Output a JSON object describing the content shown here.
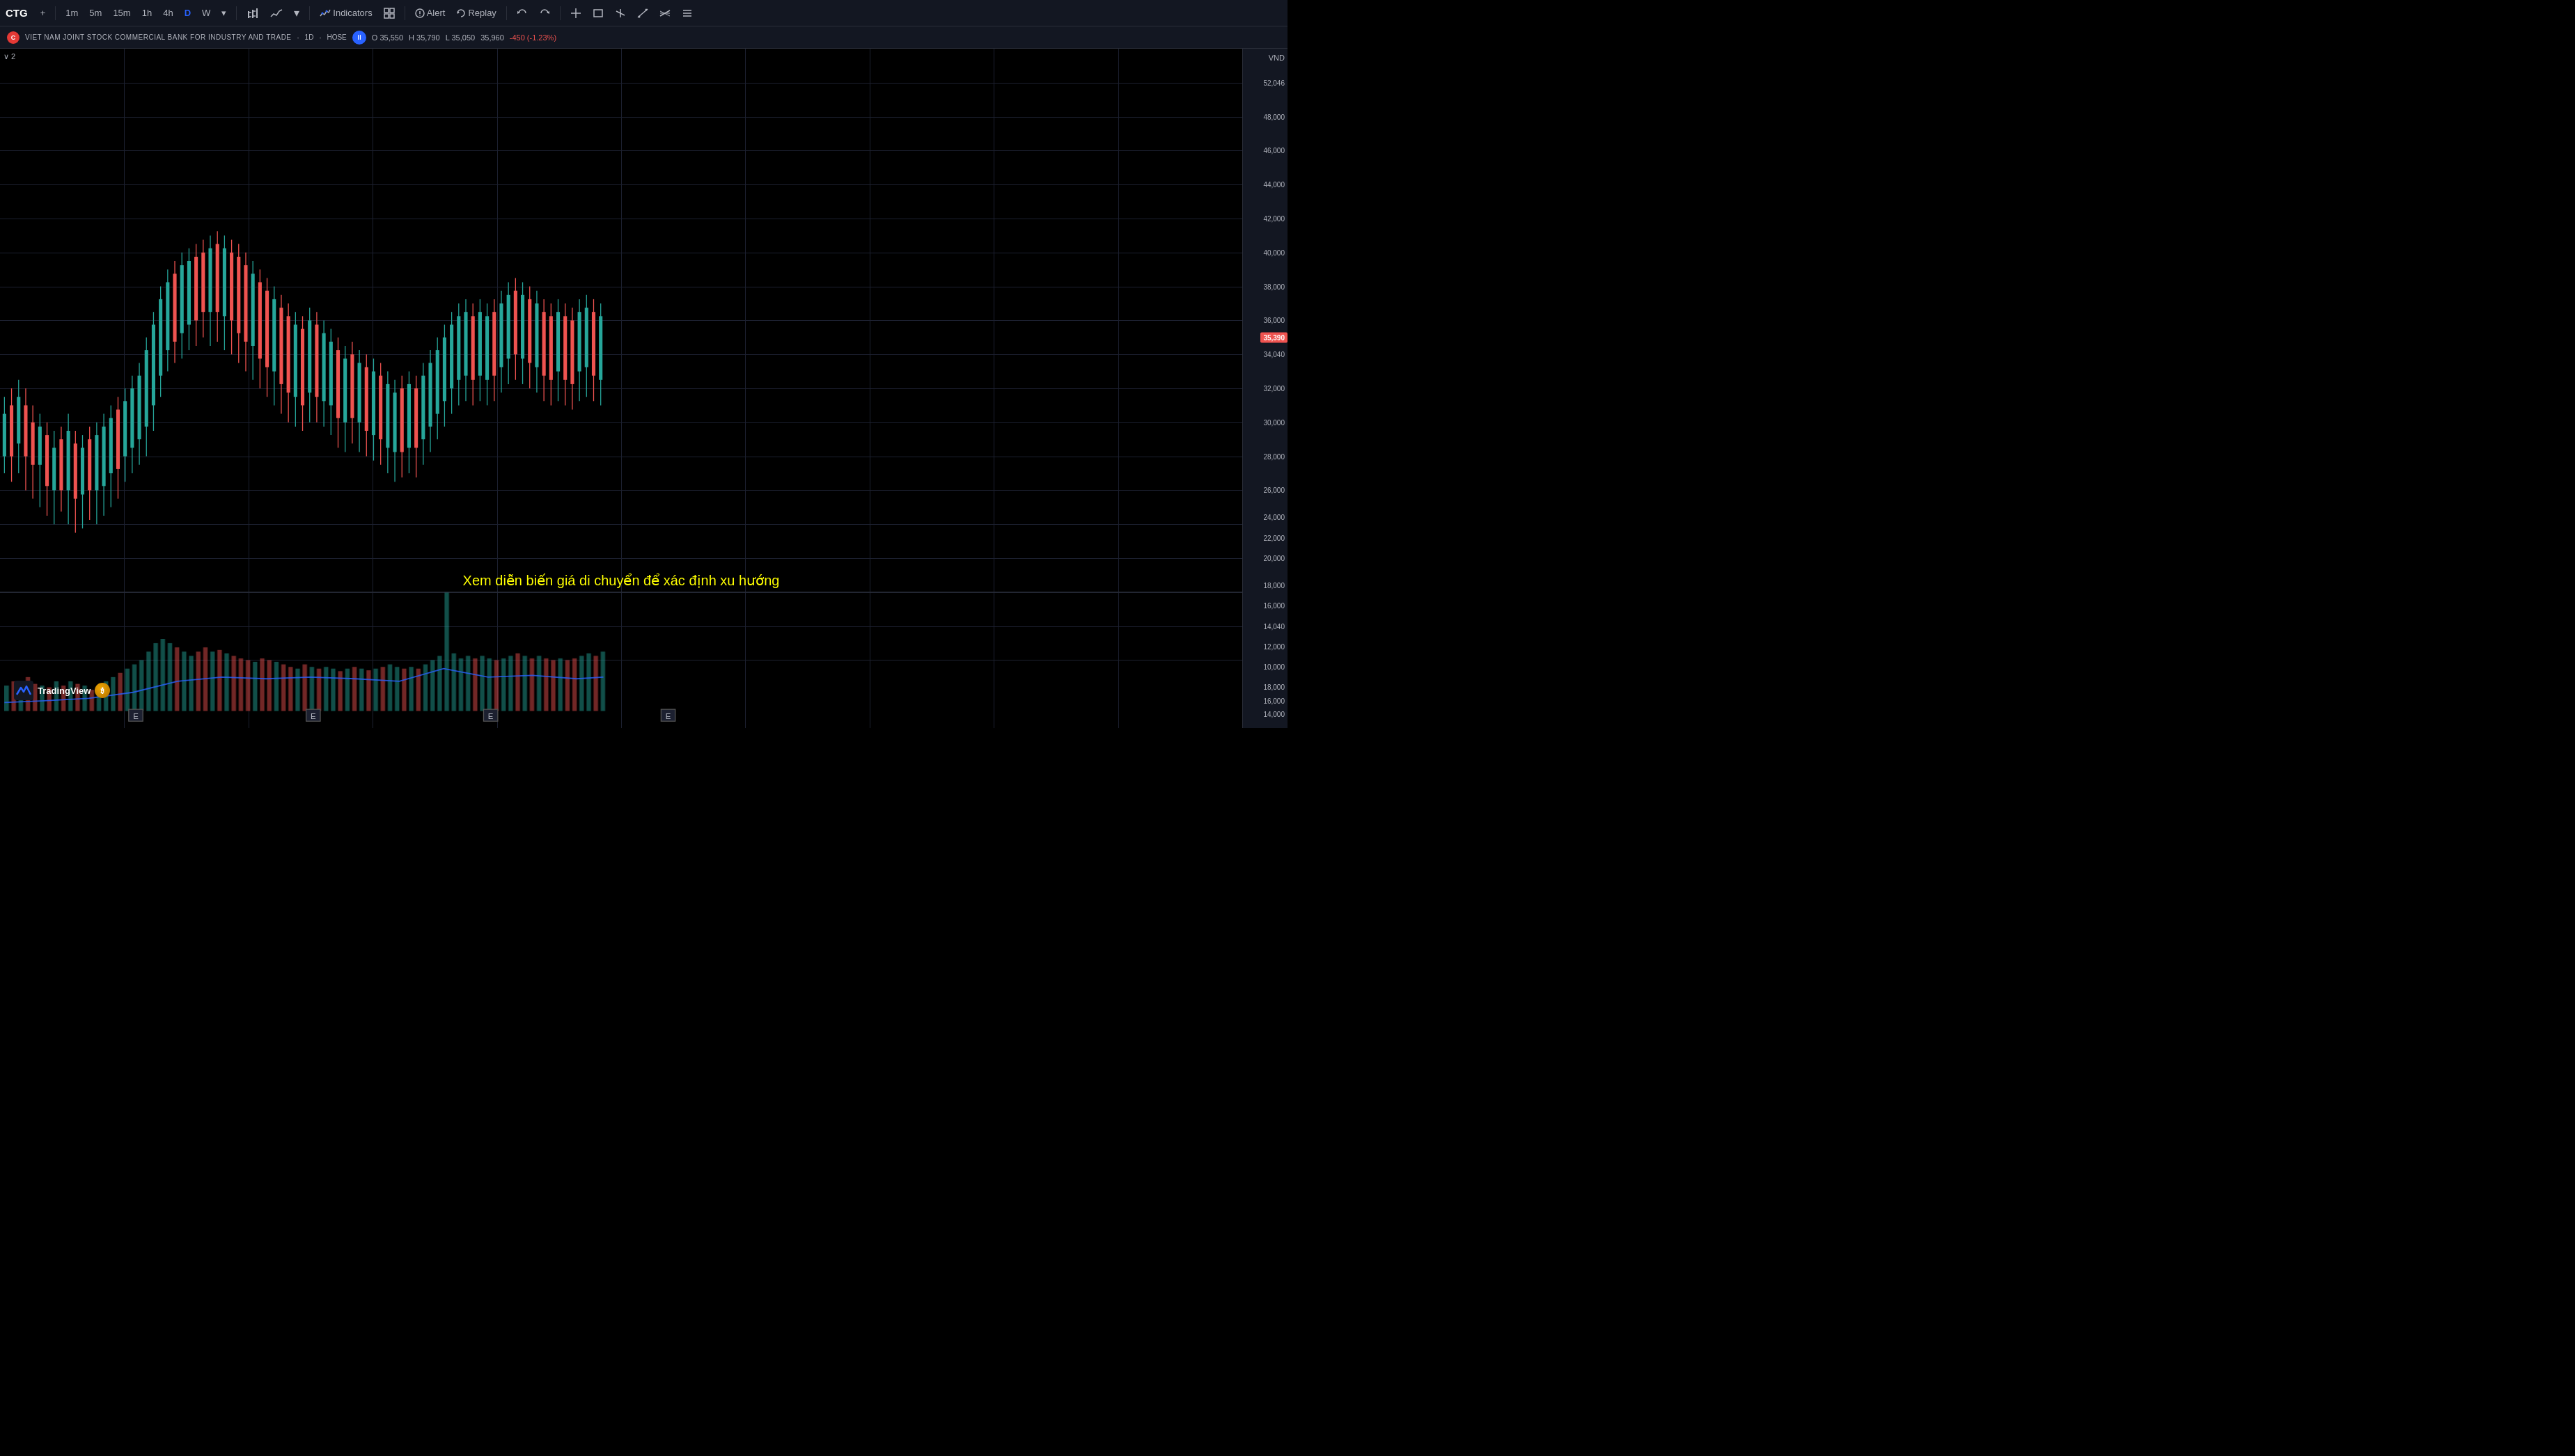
{
  "toolbar": {
    "symbol": "CTG",
    "add_label": "+",
    "timeframes": [
      "1m",
      "5m",
      "15m",
      "1h",
      "4h",
      "D",
      "W"
    ],
    "active_timeframe": "D",
    "chart_type_label": "Candlestick",
    "indicators_label": "Indicators",
    "shapes_label": "Shapes",
    "alert_label": "Alert",
    "replay_label": "Replay"
  },
  "symbol_bar": {
    "full_name": "VIET NAM JOINT STOCK COMMERCIAL BANK FOR INDUSTRY AND TRADE",
    "timeframe": "1D",
    "exchange": "HOSE",
    "open": "O 35,550",
    "high": "H 35,790",
    "low": "L 35,050",
    "close": "35,960",
    "change": "-450 (-1.23%)"
  },
  "chart": {
    "overlay_text": "Xem diễn biến giá di chuyển để xác định xu hướng",
    "legend_value": "2",
    "current_price": "35,390",
    "currency": "VND"
  },
  "price_scale": {
    "labels": [
      "52,046",
      "48,000",
      "44,000",
      "40,000",
      "38,000",
      "34,040",
      "32,000",
      "30,000",
      "28,000",
      "26,000",
      "24,000",
      "22,000",
      "20,000",
      "18,000",
      "16,000",
      "14,040",
      "12,000",
      "10,000"
    ]
  },
  "events": [
    "E",
    "E",
    "E",
    "E"
  ],
  "logo": {
    "text": "TradingView"
  }
}
